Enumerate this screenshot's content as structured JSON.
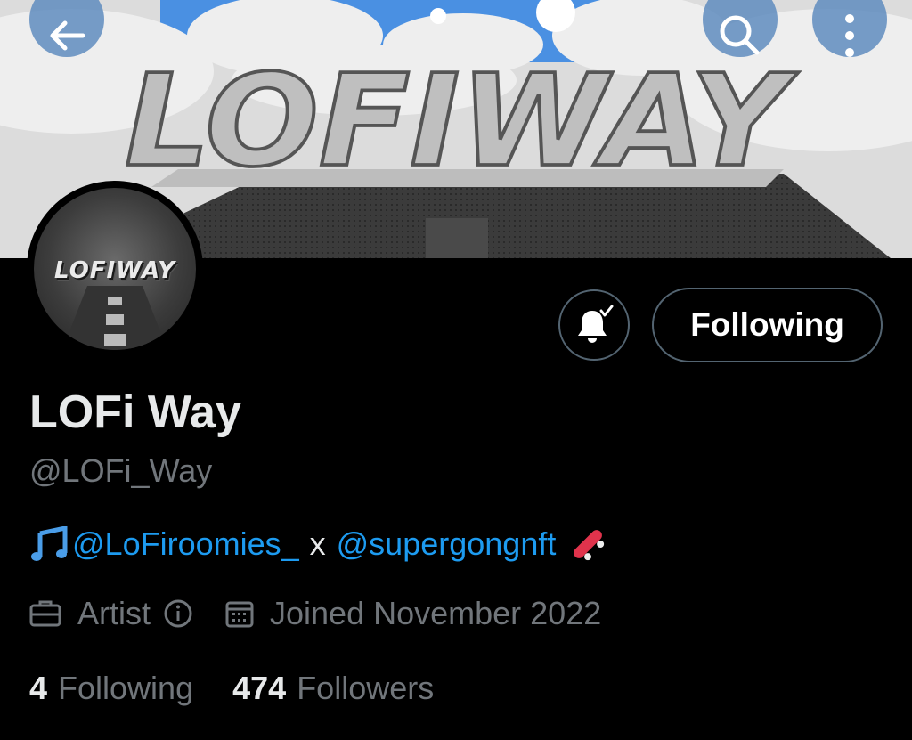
{
  "banner": {
    "logo_text": "LOFIWAY"
  },
  "nav": {
    "back": "back-arrow-icon",
    "search": "search-icon",
    "more": "more-vertical-icon"
  },
  "avatar": {
    "logo_text": "LOFIWAY"
  },
  "actions": {
    "notify": "bell-check-icon",
    "follow_label": "Following"
  },
  "profile": {
    "name": "LOFi Way",
    "handle": "@LOFi_Way",
    "bio": {
      "icon": "music-note-icon",
      "mention1": "@LoFiroomies_",
      "separator": "x",
      "mention2": "@supergongnft",
      "emoji": "skateboard-icon"
    },
    "category": "Artist",
    "joined": "Joined November 2022"
  },
  "stats": {
    "following_count": "4",
    "following_label": "Following",
    "followers_count": "474",
    "followers_label": "Followers"
  },
  "colors": {
    "link": "#1d9bf0",
    "muted": "#71767b",
    "text": "#e7e9ea",
    "background": "#000000"
  }
}
